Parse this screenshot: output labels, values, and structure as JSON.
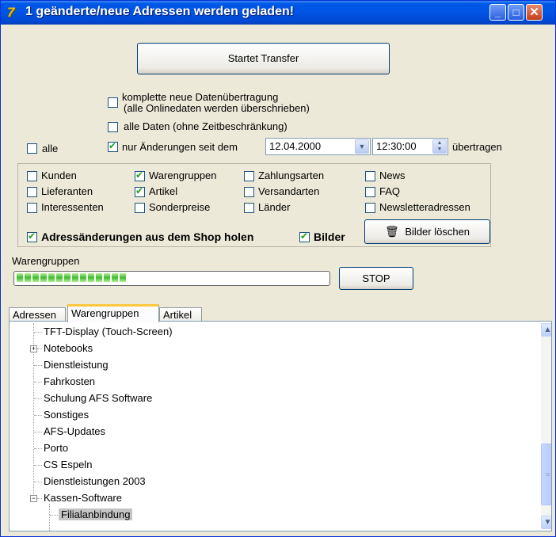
{
  "window": {
    "title": "1 geänderte/neue Adressen werden geladen!",
    "icon": "afs-app-icon",
    "minimize": "_",
    "maximize": "□",
    "close": "✕"
  },
  "transfer": {
    "start_label": "Startet Transfer",
    "full_transfer_label_line1": "komplette neue Datenübertragung",
    "full_transfer_label_line2": "(alle Onlinedaten werden überschrieben)",
    "all_data_label": "alle Daten (ohne Zeitbeschränkung)",
    "all_label": "alle",
    "changes_since_label": "nur Änderungen seit dem",
    "date_value": "12.04.2000",
    "time_value": "12:30:00",
    "transferred_label": "übertragen"
  },
  "options": {
    "kunden": "Kunden",
    "lieferanten": "Lieferanten",
    "interessenten": "Interessenten",
    "warengruppen": "Warengruppen",
    "artikel": "Artikel",
    "sonderpreise": "Sonderpreise",
    "zahlungsarten": "Zahlungsarten",
    "versandarten": "Versandarten",
    "laender": "Länder",
    "news": "News",
    "faq": "FAQ",
    "newsletter": "Newsletteradressen",
    "address_changes": "Adressänderungen aus dem Shop holen",
    "bilder": "Bilder",
    "delete_images": "Bilder löschen"
  },
  "progress": {
    "label": "Warengruppen",
    "fraction": 0.35,
    "stop_label": "STOP"
  },
  "tabs": [
    {
      "label": "Adressen"
    },
    {
      "label": "Warengruppen"
    },
    {
      "label": "Artikel"
    }
  ],
  "tree": {
    "items": [
      "TFT-Display (Touch-Screen)",
      "Notebooks",
      "Dienstleistung",
      "Fahrkosten",
      "Schulung AFS Software",
      "Sonstiges",
      "AFS-Updates",
      "Porto",
      "CS Espeln",
      "Dienstleistungen 2003",
      "Kassen-Software"
    ],
    "child": "Filialanbindung"
  },
  "colors": {
    "titlebar": "#0054e3",
    "progress": "#3fbb2c",
    "tab_highlight": "#ffc83c"
  }
}
